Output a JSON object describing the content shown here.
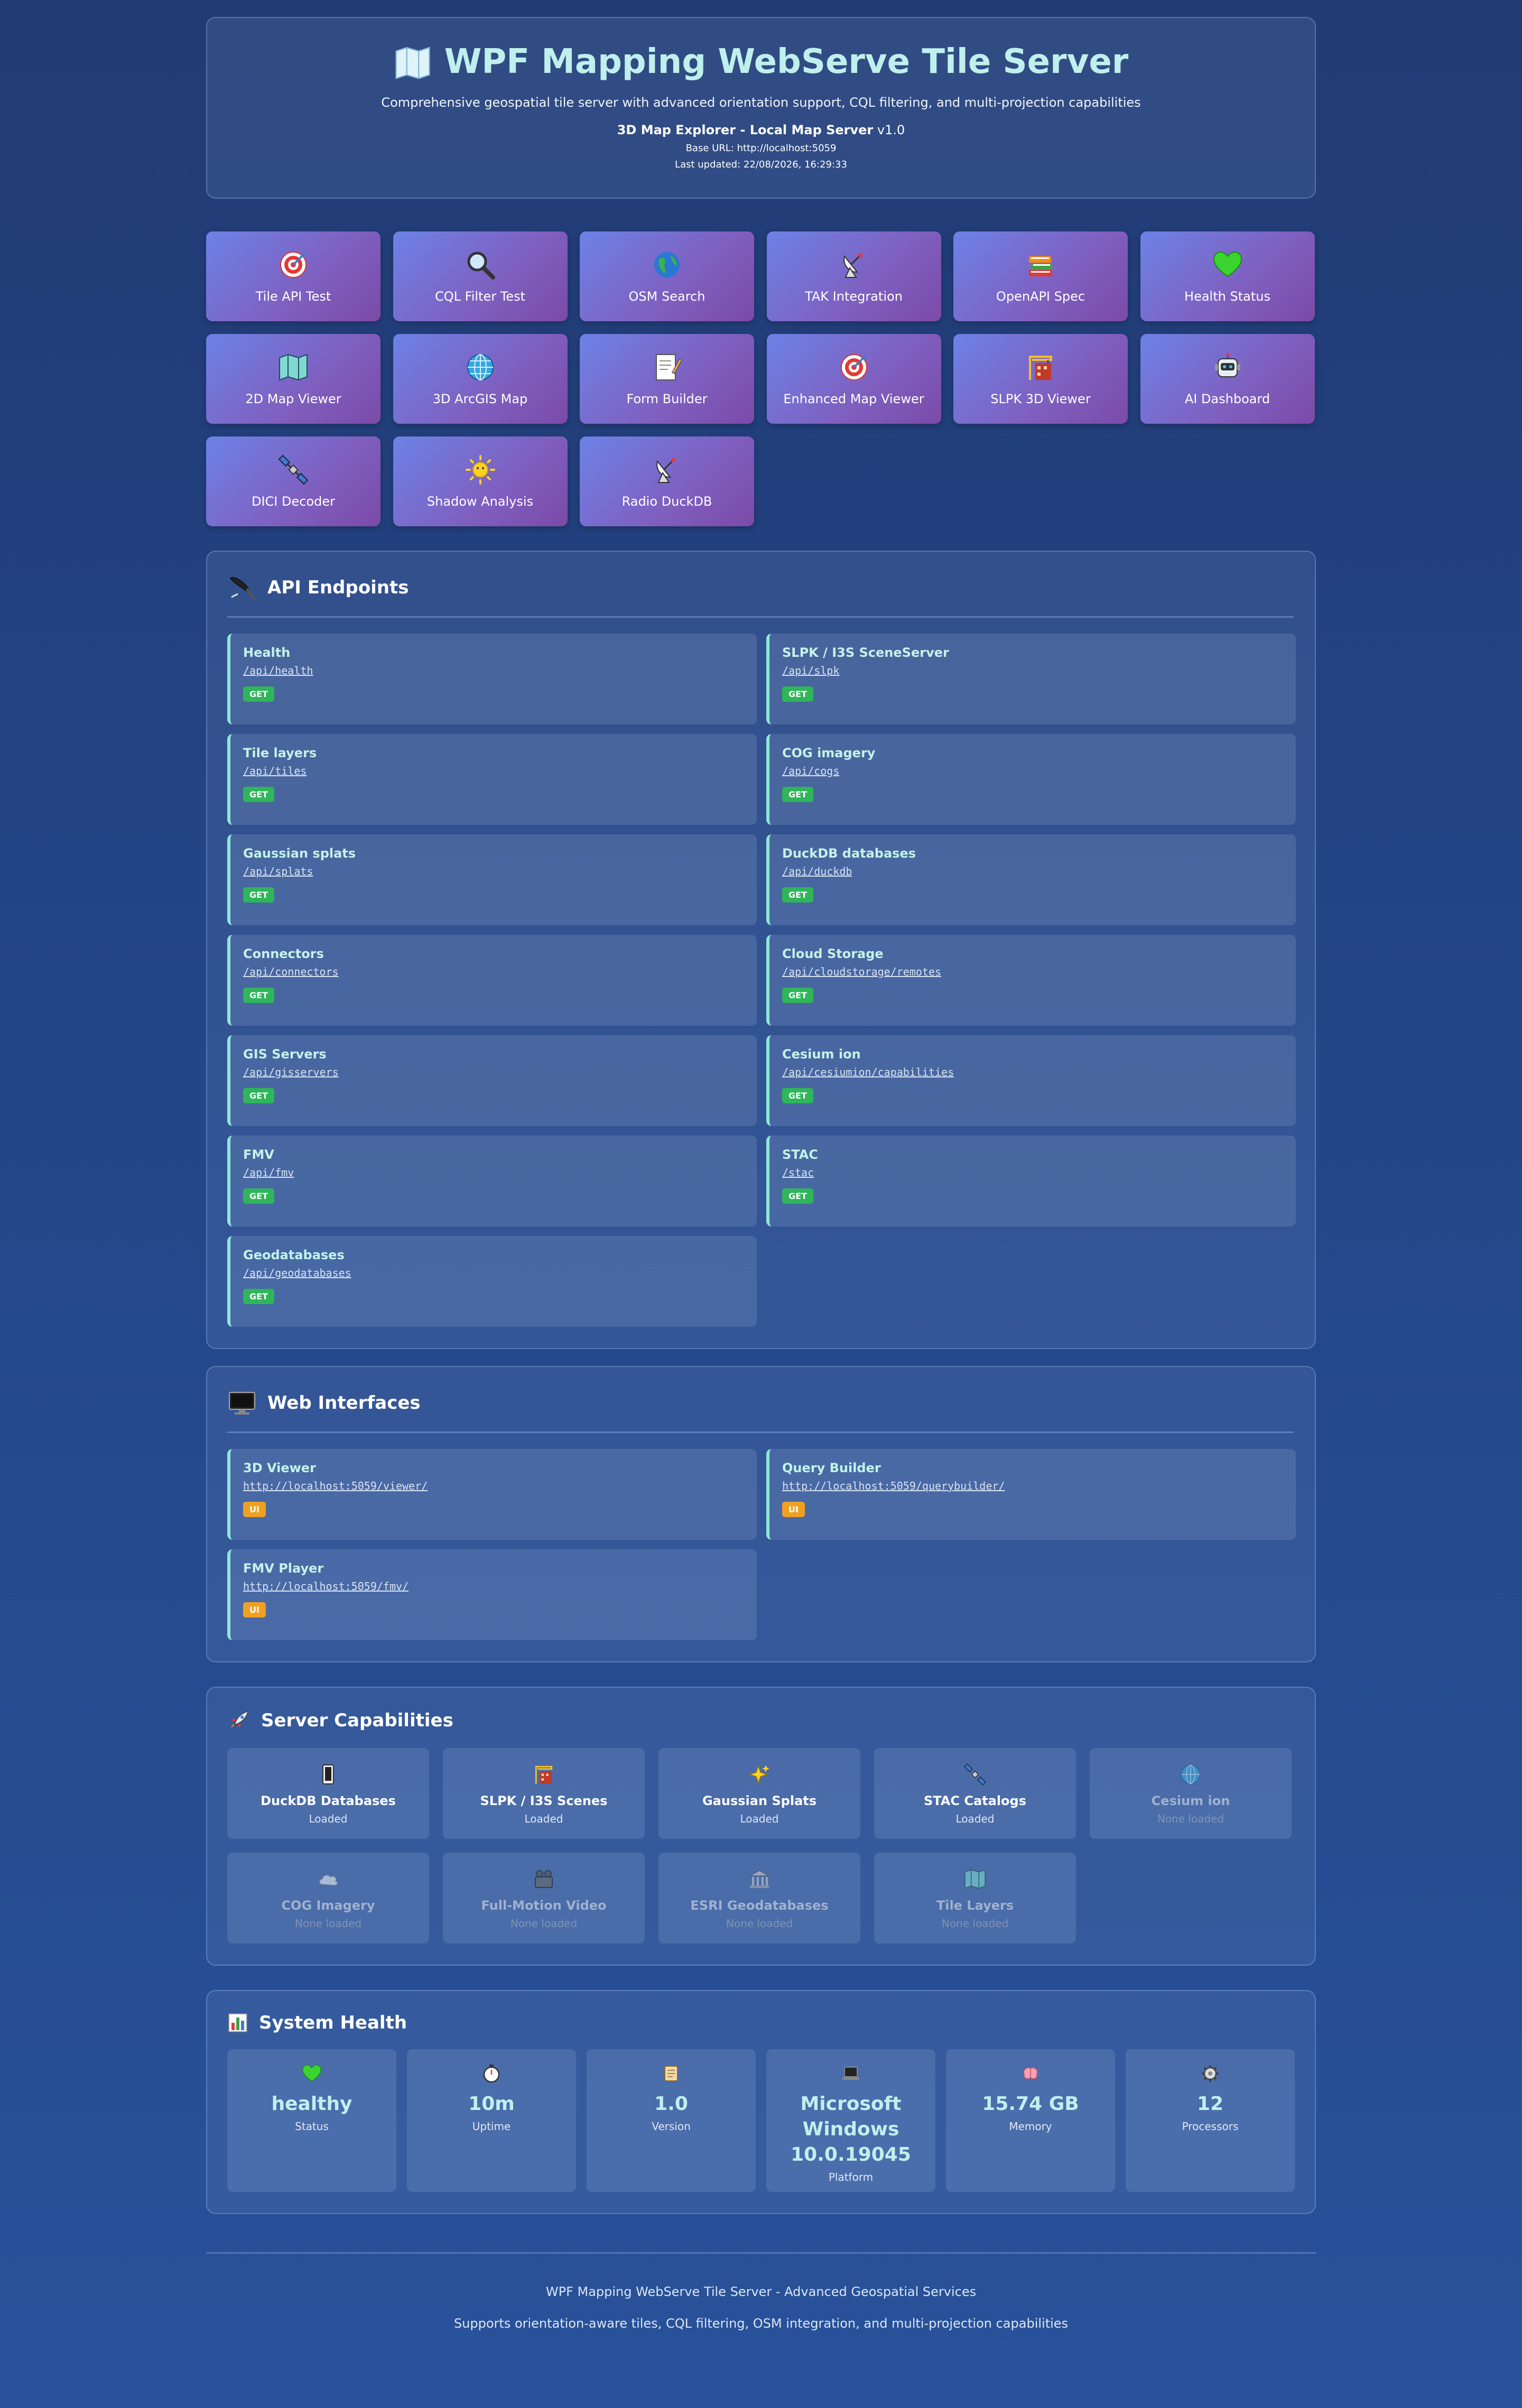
{
  "header": {
    "title": "WPF Mapping WebServe Tile Server",
    "subtitle": "Comprehensive geospatial tile server with advanced orientation support, CQL filtering, and multi-projection capabilities",
    "app_name": "3D Map Explorer - Local Map Server",
    "app_version": " v1.0",
    "base_url": "Base URL: http://localhost:5059",
    "last_updated": "Last updated: 22/08/2026, 16:29:33",
    "icon": "map-icon"
  },
  "nav": [
    {
      "label": "Tile API Test",
      "icon": "target-icon"
    },
    {
      "label": "CQL Filter Test",
      "icon": "magnifier-icon"
    },
    {
      "label": "OSM Search",
      "icon": "globe-icon"
    },
    {
      "label": "TAK Integration",
      "icon": "satellite-dish-icon"
    },
    {
      "label": "OpenAPI Spec",
      "icon": "books-icon"
    },
    {
      "label": "Health Status",
      "icon": "green-heart-icon"
    },
    {
      "label": "2D Map Viewer",
      "icon": "map-icon"
    },
    {
      "label": "3D ArcGIS Map",
      "icon": "globe-meridians-icon"
    },
    {
      "label": "Form Builder",
      "icon": "memo-icon"
    },
    {
      "label": "Enhanced Map Viewer",
      "icon": "target-icon"
    },
    {
      "label": "SLPK 3D Viewer",
      "icon": "construction-icon"
    },
    {
      "label": "AI Dashboard",
      "icon": "robot-icon"
    },
    {
      "label": "DICI Decoder",
      "icon": "satellite-icon"
    },
    {
      "label": "Shadow Analysis",
      "icon": "sun-icon"
    },
    {
      "label": "Radio DuckDB",
      "icon": "satellite-dish-icon"
    }
  ],
  "api": {
    "title": "API Endpoints",
    "icon": "pen-icon",
    "endpoints": [
      {
        "name": "Health",
        "path": "/api/health",
        "method": "GET"
      },
      {
        "name": "SLPK / I3S SceneServer",
        "path": "/api/slpk",
        "method": "GET"
      },
      {
        "name": "Tile layers",
        "path": "/api/tiles",
        "method": "GET"
      },
      {
        "name": "COG imagery",
        "path": "/api/cogs",
        "method": "GET"
      },
      {
        "name": "Gaussian splats",
        "path": "/api/splats",
        "method": "GET"
      },
      {
        "name": "DuckDB databases",
        "path": "/api/duckdb",
        "method": "GET"
      },
      {
        "name": "Connectors",
        "path": "/api/connectors",
        "method": "GET"
      },
      {
        "name": "Cloud Storage",
        "path": "/api/cloudstorage/remotes",
        "method": "GET"
      },
      {
        "name": "GIS Servers",
        "path": "/api/gisservers",
        "method": "GET"
      },
      {
        "name": "Cesium ion",
        "path": "/api/cesiumion/capabilities",
        "method": "GET"
      },
      {
        "name": "FMV",
        "path": "/api/fmv",
        "method": "GET"
      },
      {
        "name": "STAC",
        "path": "/stac",
        "method": "GET"
      },
      {
        "name": "Geodatabases",
        "path": "/api/geodatabases",
        "method": "GET"
      }
    ]
  },
  "web": {
    "title": "Web Interfaces",
    "icon": "monitor-icon",
    "items": [
      {
        "name": "3D Viewer",
        "url": "http://localhost:5059/viewer/",
        "badge": "UI"
      },
      {
        "name": "Query Builder",
        "url": "http://localhost:5059/querybuilder/",
        "badge": "UI"
      },
      {
        "name": "FMV Player",
        "url": "http://localhost:5059/fmv/",
        "badge": "UI"
      }
    ]
  },
  "capabilities": {
    "title": "Server Capabilities",
    "icon": "rocket-icon",
    "items": [
      {
        "name": "DuckDB Databases",
        "status": "Loaded",
        "icon": "database-icon",
        "active": true
      },
      {
        "name": "SLPK / I3S Scenes",
        "status": "Loaded",
        "icon": "construction-icon",
        "active": true
      },
      {
        "name": "Gaussian Splats",
        "status": "Loaded",
        "icon": "sparkles-icon",
        "active": true
      },
      {
        "name": "STAC Catalogs",
        "status": "Loaded",
        "icon": "satellite-icon",
        "active": true
      },
      {
        "name": "Cesium ion",
        "status": "None loaded",
        "icon": "globe-meridians-icon",
        "active": false
      },
      {
        "name": "COG Imagery",
        "status": "None loaded",
        "icon": "cloud-icon",
        "active": false
      },
      {
        "name": "Full-Motion Video",
        "status": "None loaded",
        "icon": "video-camera-icon",
        "active": false
      },
      {
        "name": "ESRI Geodatabases",
        "status": "None loaded",
        "icon": "bank-icon",
        "active": false
      },
      {
        "name": "Tile Layers",
        "status": "None loaded",
        "icon": "map-icon",
        "active": false
      }
    ]
  },
  "health": {
    "title": "System Health",
    "icon": "bar-chart-icon",
    "cards": [
      {
        "value": "healthy",
        "label": "Status",
        "icon": "green-heart-icon"
      },
      {
        "value": "10m",
        "label": "Uptime",
        "icon": "stopwatch-icon"
      },
      {
        "value": "1.0",
        "label": "Version",
        "icon": "scroll-icon"
      },
      {
        "value": "Microsoft Windows 10.0.19045",
        "label": "Platform",
        "icon": "laptop-icon"
      },
      {
        "value": "15.74 GB",
        "label": "Memory",
        "icon": "brain-icon"
      },
      {
        "value": "12",
        "label": "Processors",
        "icon": "gear-icon"
      }
    ]
  },
  "footer": {
    "line1": "WPF Mapping WebServe Tile Server - Advanced Geospatial Services",
    "line2": "Supports orientation-aware tiles, CQL filtering, OSM integration, and multi-projection capabilities"
  },
  "colors": {
    "background": "#24478a",
    "accent": "#bff0ee",
    "tile_gradient_start": "#6d82e6",
    "tile_gradient_end": "#7b4aa8",
    "get_badge": "#2fb55a",
    "ui_badge": "#f0a020"
  }
}
